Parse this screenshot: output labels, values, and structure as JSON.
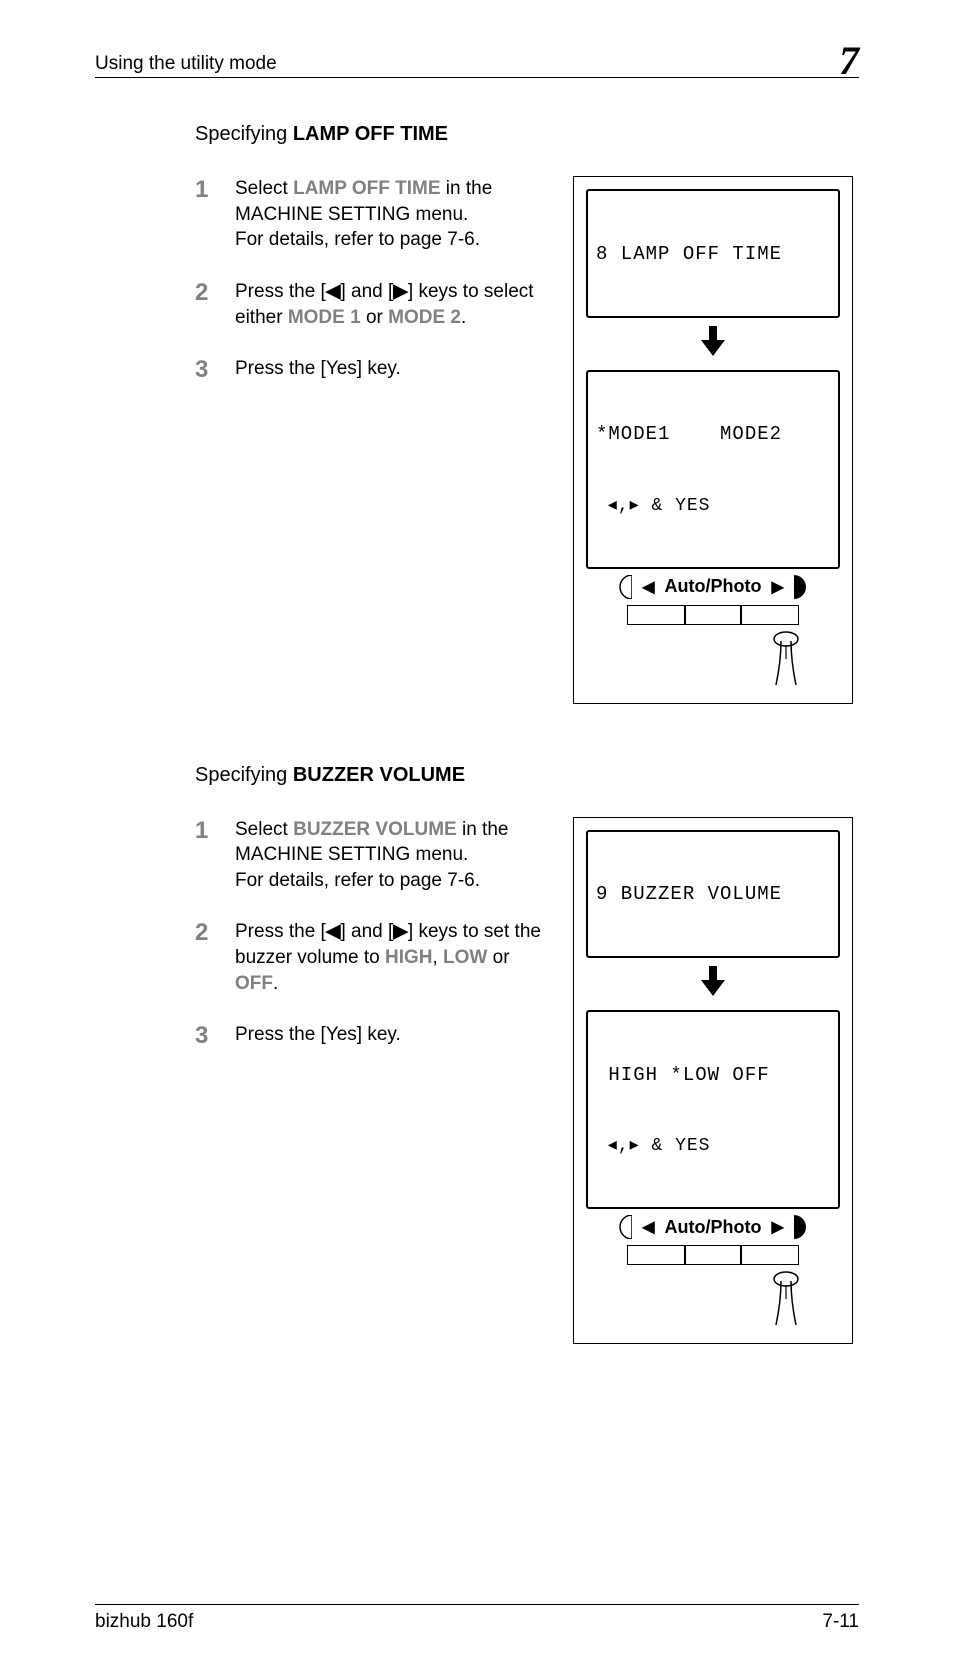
{
  "header": {
    "running_title": "Using the utility mode",
    "chapter_number": "7"
  },
  "sections": [
    {
      "heading_light": "Specifying ",
      "heading_bold": "LAMP OFF TIME",
      "steps": [
        {
          "num": "1",
          "parts": [
            {
              "t": "Select ",
              "c": ""
            },
            {
              "t": "LAMP OFF TIME",
              "c": "grey"
            },
            {
              "t": " in the MACHINE SETTING menu.\nFor details, refer to page 7-6.",
              "c": ""
            }
          ]
        },
        {
          "num": "2",
          "parts": [
            {
              "t": "Press the [",
              "c": ""
            },
            {
              "t": "◀",
              "c": "b"
            },
            {
              "t": "] and [",
              "c": ""
            },
            {
              "t": "▶",
              "c": "b"
            },
            {
              "t": "] keys to select either ",
              "c": ""
            },
            {
              "t": "MODE 1",
              "c": "grey"
            },
            {
              "t": " or ",
              "c": ""
            },
            {
              "t": "MODE 2",
              "c": "grey"
            },
            {
              "t": ".",
              "c": ""
            }
          ]
        },
        {
          "num": "3",
          "parts": [
            {
              "t": "Press the [Yes] key.",
              "c": ""
            }
          ]
        }
      ],
      "figure": {
        "lcd1_line1": "8 LAMP OFF TIME",
        "lcd2_line1": "*MODE1    MODE2",
        "lcd2_line2": " ◂,▸ & YES",
        "auto_photo_label": "Auto/Photo",
        "bar_ticks": [
          0.33,
          0.66
        ]
      }
    },
    {
      "heading_light": "Specifying ",
      "heading_bold": "BUZZER VOLUME",
      "steps": [
        {
          "num": "1",
          "parts": [
            {
              "t": "Select ",
              "c": ""
            },
            {
              "t": "BUZZER VOLUME",
              "c": "grey"
            },
            {
              "t": " in the MACHINE SETTING menu.\nFor details, refer to page 7-6.",
              "c": ""
            }
          ]
        },
        {
          "num": "2",
          "parts": [
            {
              "t": "Press the [",
              "c": ""
            },
            {
              "t": "◀",
              "c": "b"
            },
            {
              "t": "] and [",
              "c": ""
            },
            {
              "t": "▶",
              "c": "b"
            },
            {
              "t": "] keys to set the buzzer volume to ",
              "c": ""
            },
            {
              "t": "HIGH",
              "c": "grey"
            },
            {
              "t": ", ",
              "c": ""
            },
            {
              "t": "LOW",
              "c": "grey"
            },
            {
              "t": " or ",
              "c": ""
            },
            {
              "t": "OFF",
              "c": "grey"
            },
            {
              "t": ".",
              "c": ""
            }
          ]
        },
        {
          "num": "3",
          "parts": [
            {
              "t": "Press the [Yes] key.",
              "c": ""
            }
          ]
        }
      ],
      "figure": {
        "lcd1_line1": "9 BUZZER VOLUME",
        "lcd2_line1": " HIGH *LOW OFF",
        "lcd2_line2": " ◂,▸ & YES",
        "auto_photo_label": "Auto/Photo",
        "bar_ticks": [
          0.33,
          0.66
        ]
      }
    }
  ],
  "footer": {
    "left": "bizhub 160f",
    "right": "7-11"
  },
  "icons": {
    "left_tri": "◀",
    "right_tri": "▶"
  }
}
